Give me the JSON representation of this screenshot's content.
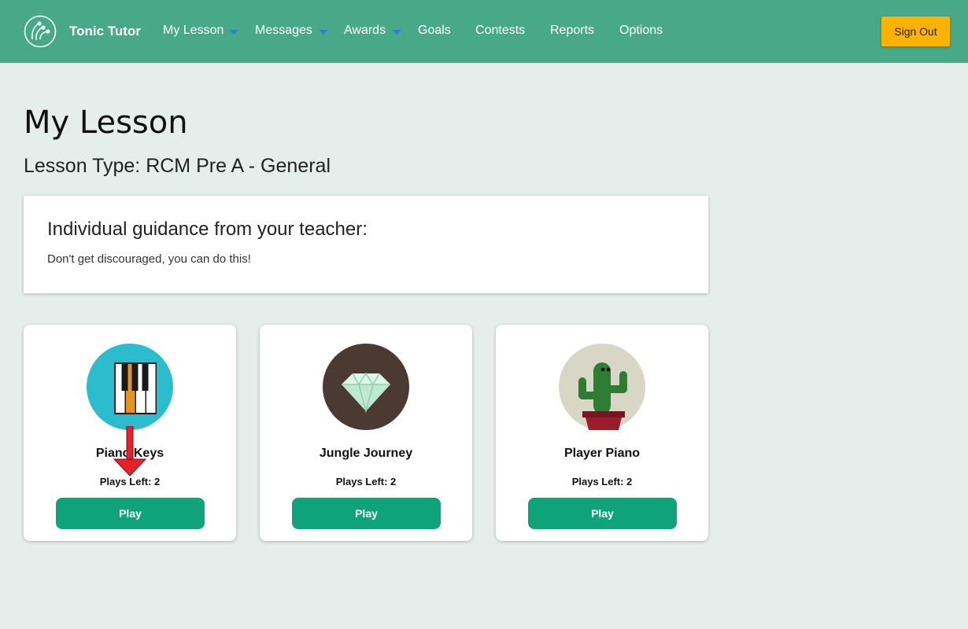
{
  "header": {
    "brand": "Tonic Tutor",
    "logo_icon": "music-notes-logo-icon",
    "nav": [
      {
        "label": "My Lesson",
        "has_dropdown": true
      },
      {
        "label": "Messages",
        "has_dropdown": true
      },
      {
        "label": "Awards",
        "has_dropdown": true
      },
      {
        "label": "Goals",
        "has_dropdown": false
      },
      {
        "label": "Contests",
        "has_dropdown": false
      },
      {
        "label": "Reports",
        "has_dropdown": false
      },
      {
        "label": "Options",
        "has_dropdown": false
      }
    ],
    "sign_out_label": "Sign Out"
  },
  "main": {
    "title": "My Lesson",
    "lesson_type": "Lesson Type: RCM Pre A - General",
    "guidance": {
      "heading": "Individual guidance from your teacher:",
      "text": "Don't get discouraged, you can do this!"
    },
    "games": [
      {
        "name": "Piano Keys",
        "plays_left": "Plays Left: 2",
        "button_label": "Play",
        "icon": "piano-keys-icon"
      },
      {
        "name": "Jungle Journey",
        "plays_left": "Plays Left: 2",
        "button_label": "Play",
        "icon": "diamond-icon"
      },
      {
        "name": "Player Piano",
        "plays_left": "Plays Left: 2",
        "button_label": "Play",
        "icon": "cactus-icon"
      }
    ]
  },
  "colors": {
    "header_bg": "#48a988",
    "page_bg": "#e6eeec",
    "play_button": "#0fa37a",
    "sign_out_button": "#ffb300",
    "dropdown_caret": "#2f7fd6",
    "annotation_arrow": "#e8202a"
  }
}
